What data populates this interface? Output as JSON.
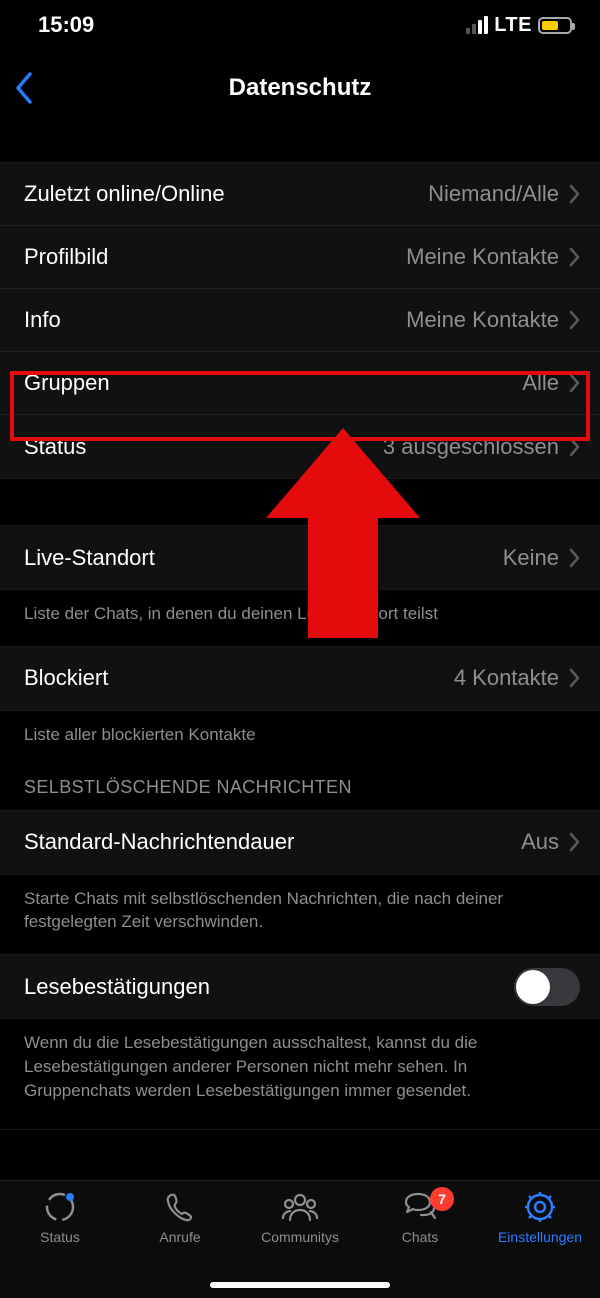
{
  "statusbar": {
    "time": "15:09",
    "network": "LTE"
  },
  "navbar": {
    "title": "Datenschutz"
  },
  "section1": {
    "lastSeen": {
      "label": "Zuletzt online/Online",
      "value": "Niemand/Alle"
    },
    "profilePic": {
      "label": "Profilbild",
      "value": "Meine Kontakte"
    },
    "about": {
      "label": "Info",
      "value": "Meine Kontakte"
    },
    "groups": {
      "label": "Gruppen",
      "value": "Alle"
    },
    "status": {
      "label": "Status",
      "value": "3 ausgeschlossen"
    }
  },
  "section2": {
    "liveLocation": {
      "label": "Live-Standort",
      "value": "Keine"
    },
    "note": "Liste der Chats, in denen du deinen Live-Standort teilst"
  },
  "section3": {
    "blocked": {
      "label": "Blockiert",
      "value": "4 Kontakte"
    },
    "note": "Liste aller blockierten Kontakte"
  },
  "section4": {
    "header": "SELBSTLÖSCHENDE NACHRICHTEN",
    "defaultTimer": {
      "label": "Standard-Nachrichtendauer",
      "value": "Aus"
    },
    "note": "Starte Chats mit selbstlöschenden Nachrichten, die nach deiner festgelegten Zeit verschwinden."
  },
  "section5": {
    "readReceipts": {
      "label": "Lesebestätigungen",
      "on": false
    },
    "note": "Wenn du die Lesebestätigungen ausschaltest, kannst du die Lesebestätigungen anderer Personen nicht mehr sehen. In Gruppenchats werden Lesebestätigungen immer gesendet."
  },
  "tabs": {
    "status": "Status",
    "calls": "Anrufe",
    "communities": "Communitys",
    "chats": "Chats",
    "chatsBadge": "7",
    "settings": "Einstellungen"
  }
}
